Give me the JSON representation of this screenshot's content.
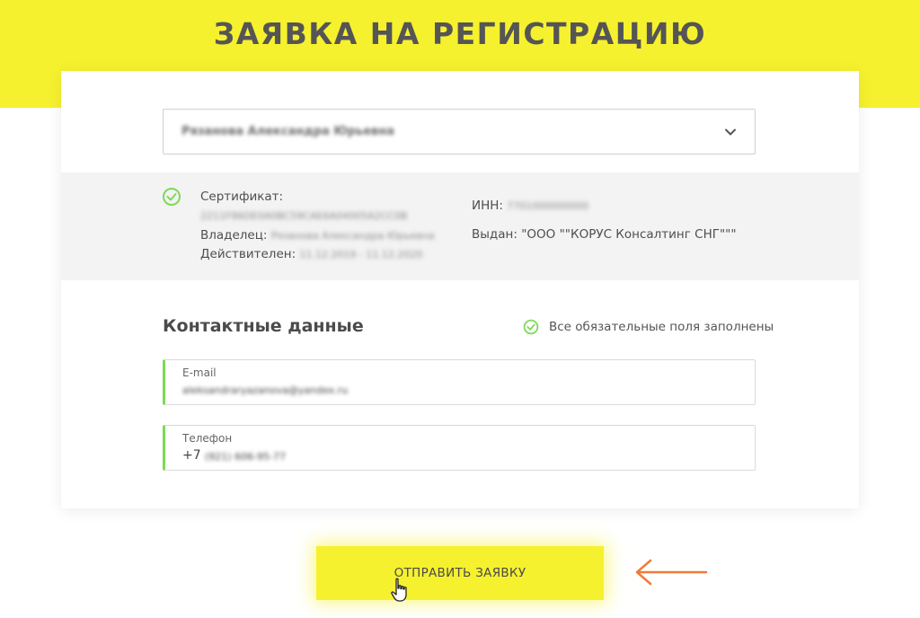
{
  "page": {
    "title": "ЗАЯВКА НА РЕГИСТРАЦИЮ"
  },
  "certificate_select": {
    "value": "Рязанова Александра Юрьевна"
  },
  "certificate": {
    "label_certificate": "Сертификат:",
    "serial": "2211F86DE0A0BC59CAE6A04005A2CC0B",
    "label_owner": "Владелец:",
    "owner": "Рязанова Александра Юрьевна",
    "label_valid": "Действителен:",
    "valid_period": "11.12.2019 - 11.12.2020",
    "label_inn": "ИНН:",
    "inn": "7701000000000",
    "label_issuer": "Выдан:",
    "issuer": "\"ООО \"\"КОРУС Консалтинг СНГ\"\"\""
  },
  "contacts": {
    "title": "Контактные данные",
    "status": "Все обязательные поля заполнены",
    "email_label": "E-mail",
    "email_value": "aleksandraryazanova@yandex.ru",
    "phone_label": "Телефон",
    "phone_prefix": "+7",
    "phone_value": "(921) 606-95-77"
  },
  "submit": {
    "label": "ОТПРАВИТЬ ЗАЯВКУ"
  },
  "colors": {
    "accent_yellow": "#f6f12e",
    "ok_green": "#7ed957",
    "arrow_orange": "#f07a3a"
  },
  "icons": [
    "chevron-down-icon",
    "check-circle-icon",
    "hand-pointer-icon",
    "arrow-left-icon"
  ]
}
